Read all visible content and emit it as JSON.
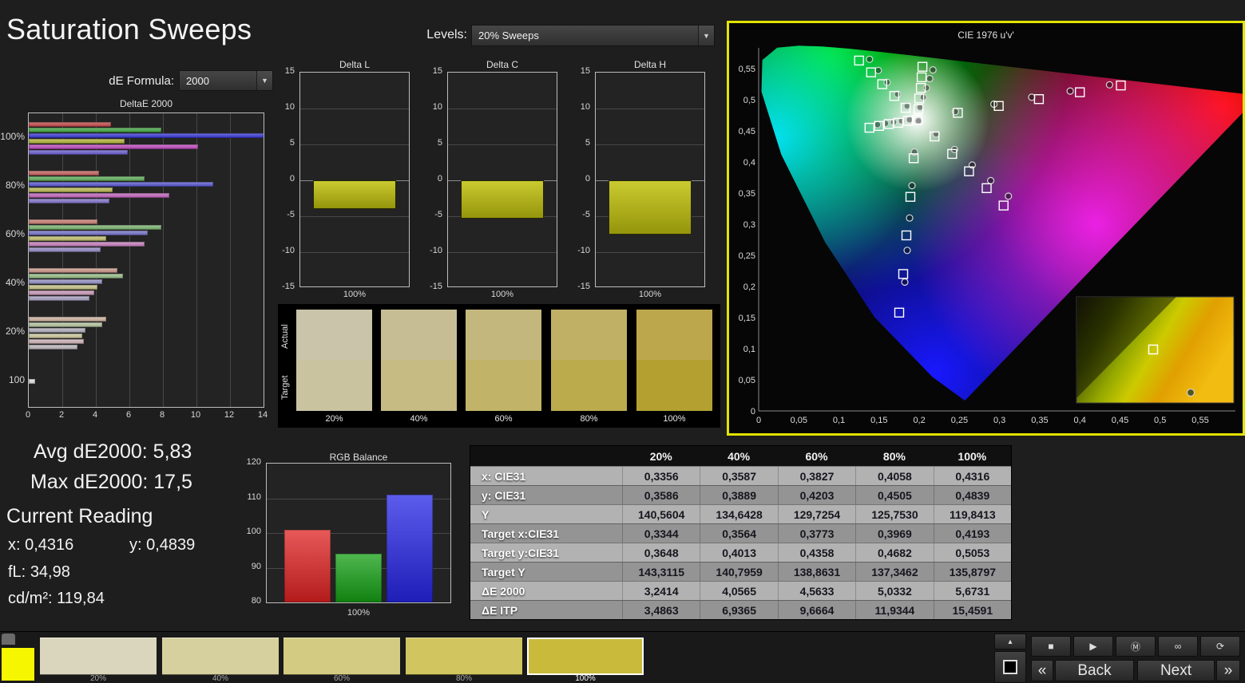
{
  "app": {
    "title": "Saturation Sweeps"
  },
  "header": {
    "de_formula_label": "dE Formula:",
    "de_formula_value": "2000",
    "levels_label": "Levels:",
    "levels_value": "20% Sweeps",
    "dropdown_arrow": "▼"
  },
  "summary": {
    "avg_label": "Avg dE2000:",
    "avg_value": "5,83",
    "max_label": "Max dE2000:",
    "max_value": "17,5"
  },
  "current_reading": {
    "heading": "Current Reading",
    "x_label": "x:",
    "x_value": "0,4316",
    "y_label": "y:",
    "y_value": "0,4839",
    "fl_label": "fL:",
    "fl_value": "34,98",
    "cd_label": "cd/m²:",
    "cd_value": "119,84"
  },
  "chart_data": [
    {
      "id": "deltaE2000",
      "type": "bar",
      "orientation": "horizontal",
      "title": "DeltaE 2000",
      "xlim": [
        0,
        14
      ],
      "xticks": [
        0,
        2,
        4,
        6,
        8,
        10,
        12,
        14
      ],
      "categories": [
        "100%",
        "80%",
        "60%",
        "40%",
        "20%",
        "100"
      ],
      "series": [
        {
          "name": "Red",
          "color": "#c24444",
          "values": [
            4.9,
            4.2,
            4.1,
            5.3,
            4.6,
            null
          ]
        },
        {
          "name": "Green",
          "color": "#3da43d",
          "values": [
            7.9,
            6.9,
            7.9,
            5.6,
            4.4,
            null
          ]
        },
        {
          "name": "Blue",
          "color": "#3434d6",
          "values": [
            17.5,
            11.0,
            7.1,
            4.4,
            3.4,
            null
          ]
        },
        {
          "name": "Yellow",
          "color": "#b4b436",
          "values": [
            5.7,
            5.0,
            4.6,
            4.1,
            3.2,
            null
          ]
        },
        {
          "name": "Magenta",
          "color": "#bc46bc",
          "values": [
            10.1,
            8.4,
            6.9,
            3.9,
            3.3,
            null
          ]
        },
        {
          "name": "Cyan",
          "color": "#6a5ace",
          "values": [
            5.9,
            4.8,
            4.3,
            3.6,
            2.9,
            null
          ]
        },
        {
          "name": "White",
          "color": "#e2e2e2",
          "values": [
            null,
            null,
            null,
            null,
            null,
            0.4
          ]
        }
      ]
    },
    {
      "id": "delta_l",
      "type": "bar",
      "title": "Delta L",
      "ylim": [
        -15,
        15
      ],
      "yticks": [
        15,
        10,
        5,
        0,
        -5,
        -10,
        -15
      ],
      "xlabel": "100%",
      "value": -4.0,
      "bar_color": "#bdbd2a"
    },
    {
      "id": "delta_c",
      "type": "bar",
      "title": "Delta C",
      "ylim": [
        -15,
        15
      ],
      "yticks": [
        15,
        10,
        5,
        0,
        -5,
        -10,
        -15
      ],
      "xlabel": "100%",
      "value": -5.3,
      "bar_color": "#bdbd2a"
    },
    {
      "id": "delta_h",
      "type": "bar",
      "title": "Delta H",
      "ylim": [
        -15,
        15
      ],
      "yticks": [
        15,
        10,
        5,
        0,
        -5,
        -10,
        -15
      ],
      "xlabel": "100%",
      "value": -7.6,
      "bar_color": "#bdbd2a"
    },
    {
      "id": "rgb_balance",
      "type": "bar",
      "title": "RGB Balance",
      "categories": [
        "Red",
        "Green",
        "Blue"
      ],
      "values": [
        101,
        94,
        111
      ],
      "colors": [
        "#e02222",
        "#14a014",
        "#2626e6"
      ],
      "ylim": [
        80,
        120
      ],
      "yticks": [
        120,
        110,
        100,
        90,
        80
      ],
      "xlabel": "100%"
    },
    {
      "id": "cie",
      "type": "scatter",
      "title": "CIE 1976 u'v'",
      "xlim": [
        0,
        0.594
      ],
      "ylim": [
        0,
        0.583
      ],
      "xtick_labels": [
        "0",
        "0,05",
        "0,1",
        "0,15",
        "0,2",
        "0,25",
        "0,3",
        "0,35",
        "0,4",
        "0,45",
        "0,5",
        "0,55"
      ],
      "ytick_labels": [
        "0",
        "0,05",
        "0,1",
        "0,15",
        "0,2",
        "0,25",
        "0,3",
        "0,35",
        "0,4",
        "0,45",
        "0,5",
        "0,55"
      ],
      "border_color": "#e3e300",
      "targets": [
        [
          0.198,
          0.468
        ],
        [
          0.248,
          0.479
        ],
        [
          0.299,
          0.49
        ],
        [
          0.349,
          0.501
        ],
        [
          0.4,
          0.512
        ],
        [
          0.451,
          0.523
        ],
        [
          0.183,
          0.487
        ],
        [
          0.169,
          0.506
        ],
        [
          0.154,
          0.525
        ],
        [
          0.14,
          0.544
        ],
        [
          0.125,
          0.563
        ],
        [
          0.193,
          0.406
        ],
        [
          0.189,
          0.344
        ],
        [
          0.184,
          0.282
        ],
        [
          0.18,
          0.22
        ],
        [
          0.175,
          0.158
        ],
        [
          0.186,
          0.466
        ],
        [
          0.174,
          0.463
        ],
        [
          0.162,
          0.461
        ],
        [
          0.15,
          0.458
        ],
        [
          0.138,
          0.455
        ],
        [
          0.219,
          0.441
        ],
        [
          0.241,
          0.413
        ],
        [
          0.262,
          0.385
        ],
        [
          0.284,
          0.358
        ],
        [
          0.305,
          0.33
        ],
        [
          0.199,
          0.485
        ],
        [
          0.2,
          0.502
        ],
        [
          0.202,
          0.519
        ],
        [
          0.203,
          0.536
        ],
        [
          0.204,
          0.553
        ]
      ],
      "measurements": [
        [
          0.199,
          0.466
        ],
        [
          0.245,
          0.481
        ],
        [
          0.293,
          0.493
        ],
        [
          0.34,
          0.504
        ],
        [
          0.388,
          0.514
        ],
        [
          0.437,
          0.524
        ],
        [
          0.185,
          0.49
        ],
        [
          0.173,
          0.509
        ],
        [
          0.16,
          0.528
        ],
        [
          0.149,
          0.547
        ],
        [
          0.138,
          0.565
        ],
        [
          0.194,
          0.416
        ],
        [
          0.191,
          0.362
        ],
        [
          0.188,
          0.31
        ],
        [
          0.185,
          0.258
        ],
        [
          0.182,
          0.207
        ],
        [
          0.188,
          0.468
        ],
        [
          0.178,
          0.466
        ],
        [
          0.168,
          0.464
        ],
        [
          0.158,
          0.462
        ],
        [
          0.148,
          0.46
        ],
        [
          0.221,
          0.445
        ],
        [
          0.244,
          0.42
        ],
        [
          0.266,
          0.395
        ],
        [
          0.289,
          0.37
        ],
        [
          0.311,
          0.345
        ],
        [
          0.201,
          0.488
        ],
        [
          0.205,
          0.504
        ],
        [
          0.209,
          0.519
        ],
        [
          0.213,
          0.534
        ],
        [
          0.217,
          0.548
        ]
      ]
    }
  ],
  "comparison": {
    "row_labels": [
      "Actual",
      "Target"
    ],
    "levels": [
      "20%",
      "40%",
      "60%",
      "80%",
      "100%"
    ],
    "actual_colors": [
      "#c9c4aa",
      "#c7bd95",
      "#c3b77d",
      "#c0b065",
      "#bca74c"
    ],
    "target_colors": [
      "#c9c3a0",
      "#c5bb83",
      "#c1b468",
      "#bcab4d",
      "#b4a031"
    ]
  },
  "table": {
    "headers": [
      "",
      "20%",
      "40%",
      "60%",
      "80%",
      "100%"
    ],
    "rows": [
      {
        "label": "x: CIE31",
        "values": [
          "0,3356",
          "0,3587",
          "0,3827",
          "0,4058",
          "0,4316"
        ]
      },
      {
        "label": "y: CIE31",
        "values": [
          "0,3586",
          "0,3889",
          "0,4203",
          "0,4505",
          "0,4839"
        ]
      },
      {
        "label": "Y",
        "values": [
          "140,5604",
          "134,6428",
          "129,7254",
          "125,7530",
          "119,8413"
        ]
      },
      {
        "label": "Target x:CIE31",
        "values": [
          "0,3344",
          "0,3564",
          "0,3773",
          "0,3969",
          "0,4193"
        ]
      },
      {
        "label": "Target y:CIE31",
        "values": [
          "0,3648",
          "0,4013",
          "0,4358",
          "0,4682",
          "0,5053"
        ]
      },
      {
        "label": "Target Y",
        "values": [
          "143,3115",
          "140,7959",
          "138,8631",
          "137,3462",
          "135,8797"
        ]
      },
      {
        "label": "ΔE 2000",
        "values": [
          "3,2414",
          "4,0565",
          "4,5633",
          "5,0332",
          "5,6731"
        ]
      },
      {
        "label": "ΔE ITP",
        "values": [
          "3,4863",
          "6,9365",
          "9,6664",
          "11,9344",
          "15,4591"
        ]
      }
    ]
  },
  "strip": {
    "labels": [
      "20%",
      "40%",
      "60%",
      "80%",
      "100%"
    ],
    "colors": [
      "#d9d6bd",
      "#d6d09e",
      "#d3cb82",
      "#d0c55e",
      "#c9ba3b"
    ],
    "selected_index": 4,
    "current_patch_color": "#f6f600"
  },
  "transport": {
    "eject_glyph": "▴",
    "stop_big_glyph": "■",
    "small_buttons": [
      {
        "name": "stop",
        "glyph": "■"
      },
      {
        "name": "play",
        "glyph": "▶"
      },
      {
        "name": "marker",
        "glyph": "Ⓜ"
      },
      {
        "name": "loop",
        "glyph": "∞"
      },
      {
        "name": "refresh",
        "glyph": "⟳"
      }
    ],
    "prev_glyph": "«",
    "back_label": "Back",
    "next_label": "Next",
    "next_glyph": "»"
  }
}
